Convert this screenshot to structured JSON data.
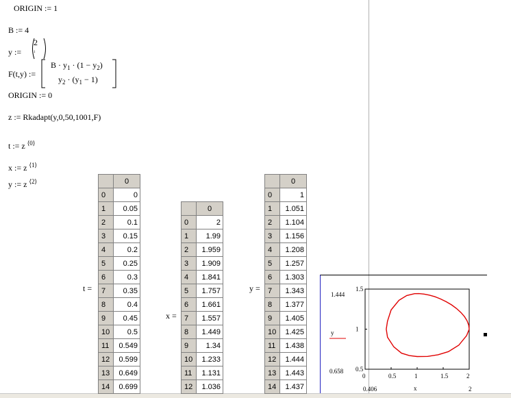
{
  "worksheet": {
    "origin1": "ORIGIN := 1",
    "b_def": "B := 4",
    "y_lhs": "y :=",
    "y_vec_top": "2",
    "y_vec_bottom": "1",
    "f_lhs": "F(t,y) :=",
    "f_row1_prefix": "B · y",
    "f_row1_sub1": "1",
    "f_row1_mid": " · (1 − y",
    "f_row1_sub2": "2",
    "f_row1_end": ")",
    "f_row2_prefix": "y",
    "f_row2_sub1": "2",
    "f_row2_mid": " · (y",
    "f_row2_sub2": "1",
    "f_row2_end": " − 1)",
    "origin0": "ORIGIN := 0",
    "z_def": "z := Rkadapt(y,0,50,1001,F)",
    "t_def": "t := z",
    "t_sup": "⟨0⟩",
    "x_def": "x := z",
    "x_sup": "⟨1⟩",
    "yz_def": "y := z",
    "y_sup": "⟨2⟩"
  },
  "tables": {
    "t": {
      "label": "t =",
      "header": "0",
      "rows": [
        [
          "0",
          "0"
        ],
        [
          "1",
          "0.05"
        ],
        [
          "2",
          "0.1"
        ],
        [
          "3",
          "0.15"
        ],
        [
          "4",
          "0.2"
        ],
        [
          "5",
          "0.25"
        ],
        [
          "6",
          "0.3"
        ],
        [
          "7",
          "0.35"
        ],
        [
          "8",
          "0.4"
        ],
        [
          "9",
          "0.45"
        ],
        [
          "10",
          "0.5"
        ],
        [
          "11",
          "0.549"
        ],
        [
          "12",
          "0.599"
        ],
        [
          "13",
          "0.649"
        ],
        [
          "14",
          "0.699"
        ]
      ]
    },
    "x": {
      "label": "x =",
      "header": "0",
      "rows": [
        [
          "0",
          "2"
        ],
        [
          "1",
          "1.99"
        ],
        [
          "2",
          "1.959"
        ],
        [
          "3",
          "1.909"
        ],
        [
          "4",
          "1.841"
        ],
        [
          "5",
          "1.757"
        ],
        [
          "6",
          "1.661"
        ],
        [
          "7",
          "1.557"
        ],
        [
          "8",
          "1.449"
        ],
        [
          "9",
          "1.34"
        ],
        [
          "10",
          "1.233"
        ],
        [
          "11",
          "1.131"
        ],
        [
          "12",
          "1.036"
        ]
      ]
    },
    "y": {
      "label": "y =",
      "header": "0",
      "rows": [
        [
          "0",
          "1"
        ],
        [
          "1",
          "1.051"
        ],
        [
          "2",
          "1.104"
        ],
        [
          "3",
          "1.156"
        ],
        [
          "4",
          "1.208"
        ],
        [
          "5",
          "1.257"
        ],
        [
          "6",
          "1.303"
        ],
        [
          "7",
          "1.343"
        ],
        [
          "8",
          "1.377"
        ],
        [
          "9",
          "1.405"
        ],
        [
          "10",
          "1.425"
        ],
        [
          "11",
          "1.438"
        ],
        [
          "12",
          "1.444"
        ],
        [
          "13",
          "1.443"
        ],
        [
          "14",
          "1.437"
        ]
      ]
    }
  },
  "plot": {
    "y_max_label": "1.444",
    "y_min_label": "0.658",
    "x_min_label": "0.406",
    "x_max_label": "2",
    "y_axis_name": "y",
    "x_axis_name": "x",
    "y_ticks": [
      "1.5",
      "1",
      "0.5"
    ],
    "x_ticks": [
      "0",
      "0.5",
      "1",
      "1.5",
      "2"
    ],
    "curve_color": "#e00000",
    "legend_color": "#e00000"
  },
  "chart_data": {
    "type": "line",
    "xlabel": "x",
    "ylabel": "y",
    "xlim": [
      0,
      2
    ],
    "ylim": [
      0.5,
      1.5
    ],
    "series": [
      {
        "name": "y",
        "x": [
          2,
          1.99,
          1.959,
          1.909,
          1.841,
          1.757,
          1.661,
          1.557,
          1.449,
          1.34,
          1.233,
          1.131,
          1.036,
          0.95,
          0.8,
          0.65,
          0.5,
          0.43,
          0.406,
          0.43,
          0.55,
          0.7,
          0.85,
          1.0,
          1.2,
          1.4,
          1.6,
          1.8,
          1.95,
          2
        ],
        "y": [
          1,
          1.051,
          1.104,
          1.156,
          1.208,
          1.257,
          1.303,
          1.343,
          1.377,
          1.405,
          1.425,
          1.438,
          1.444,
          1.443,
          1.42,
          1.36,
          1.24,
          1.1,
          1.0,
          0.9,
          0.78,
          0.7,
          0.67,
          0.658,
          0.66,
          0.68,
          0.72,
          0.8,
          0.92,
          1
        ]
      }
    ]
  }
}
